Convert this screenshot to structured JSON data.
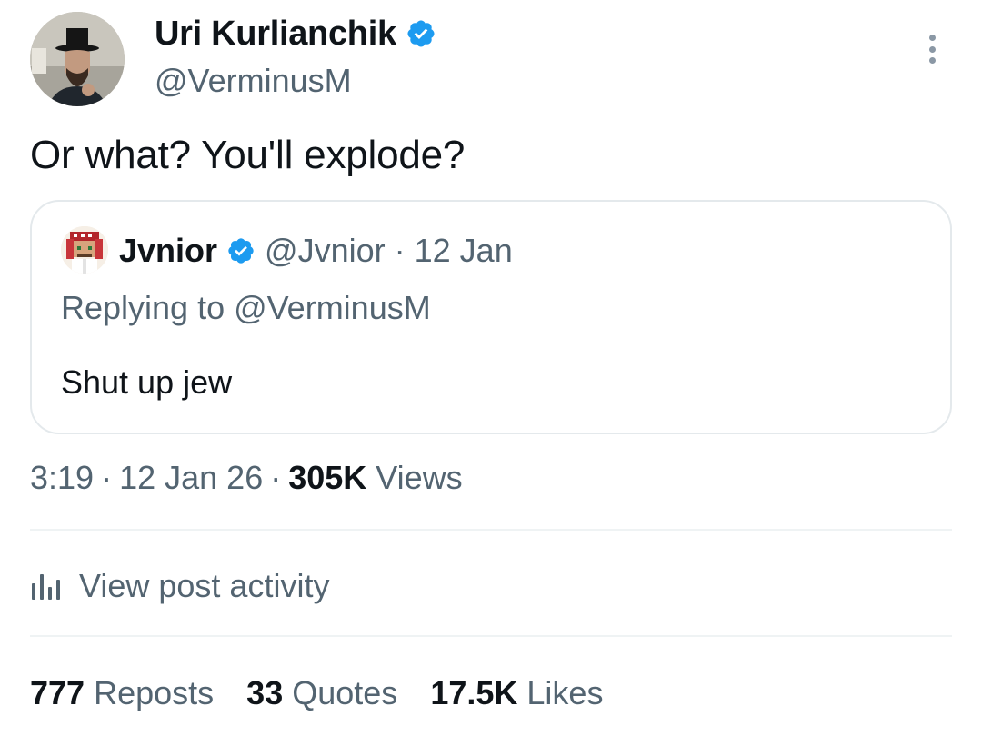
{
  "author": {
    "display_name": "Uri Kurlianchik",
    "handle": "@VerminusM",
    "verified": true,
    "avatar_icon": "profile-photo-man-top-hat"
  },
  "menu_icon": "more-options-icon",
  "tweet": {
    "text": "Or what? You'll explode?"
  },
  "quoted": {
    "display_name": "Jvnior",
    "handle": "@Jvnior",
    "separator": "·",
    "date": "12 Jan",
    "replying_to": "Replying to @VerminusM",
    "text": "Shut up jew",
    "avatar_icon": "pixel-art-avatar"
  },
  "meta": {
    "time": "3:19",
    "separator": "·",
    "date": "12 Jan 26",
    "views_count": "305K",
    "views_label": "Views"
  },
  "activity": {
    "label": "View post activity",
    "icon": "analytics-bars-icon"
  },
  "stats": [
    {
      "count": "777",
      "label": "Reposts"
    },
    {
      "count": "33",
      "label": "Quotes"
    },
    {
      "count": "17.5K",
      "label": "Likes"
    }
  ],
  "colors": {
    "text_primary": "#0f1419",
    "text_secondary": "#536471",
    "verified_blue": "#1d9bf0",
    "border": "#e4e9ec"
  }
}
